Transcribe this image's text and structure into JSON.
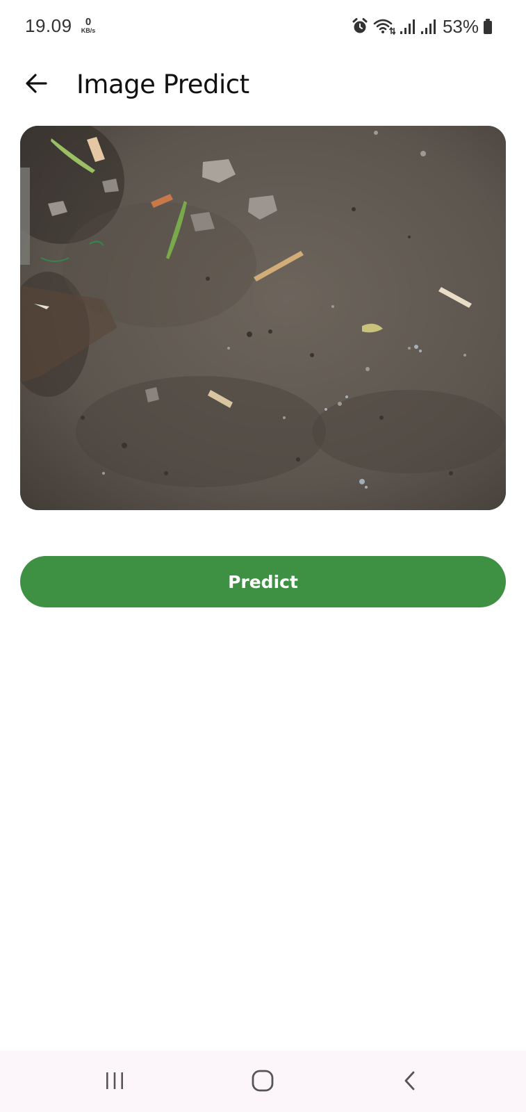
{
  "status_bar": {
    "time": "19.09",
    "net_speed_value": "0",
    "net_speed_unit": "KB/s",
    "battery_percent": "53%",
    "icons": [
      "alarm-icon",
      "wifi-icon",
      "signal-icon",
      "signal-icon",
      "battery-icon"
    ]
  },
  "app_bar": {
    "title": "Image Predict",
    "back_icon": "arrow-left-icon"
  },
  "image_preview": {
    "subject": "photo of dirt ground with debris"
  },
  "actions": {
    "predict_label": "Predict"
  },
  "nav_bar": {
    "icons": [
      "recent-apps-icon",
      "home-icon",
      "back-icon"
    ]
  },
  "colors": {
    "primary_green": "#3e9143",
    "nav_background": "#fcf6fb",
    "background": "#ffffff"
  }
}
